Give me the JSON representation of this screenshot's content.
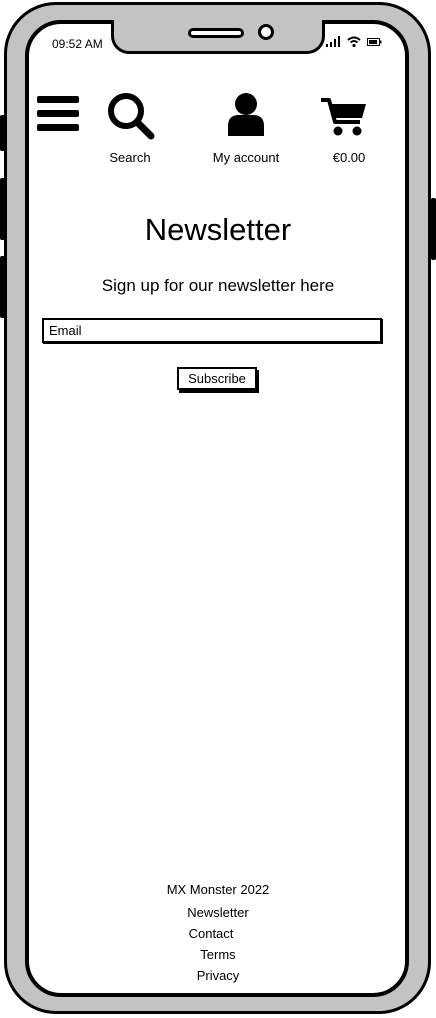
{
  "status_bar": {
    "time": "09:52 AM"
  },
  "header": {
    "menu_icon": "hamburger-icon",
    "search_label": "Search",
    "account_label": "My account",
    "cart_total": "€0.00"
  },
  "main": {
    "title": "Newsletter",
    "subtitle": "Sign up for our newsletter here",
    "email_placeholder": "Email",
    "subscribe_label": "Subscribe"
  },
  "footer": {
    "copyright": "MX Monster 2022",
    "links": [
      "Newsletter",
      "Contact",
      "Terms",
      "Privacy"
    ]
  }
}
